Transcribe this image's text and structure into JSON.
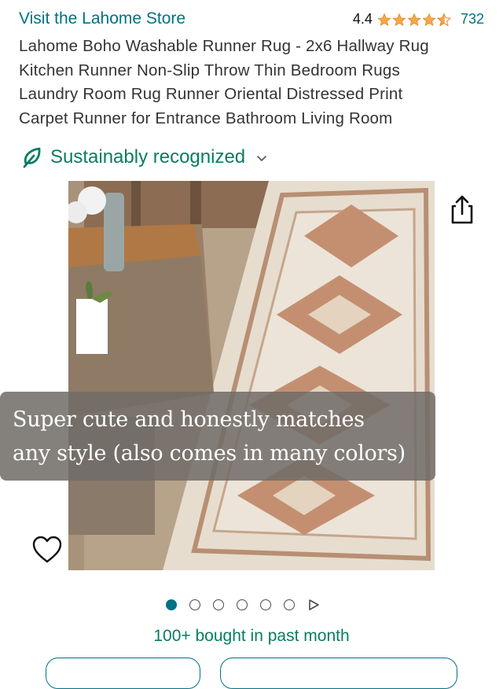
{
  "store": {
    "link_text": "Visit the Lahome Store"
  },
  "rating": {
    "value": "4.4",
    "stars": 4.4,
    "review_count": "732",
    "star_color": "#f3a847"
  },
  "product": {
    "title_lines": [
      "Lahome Boho Washable Runner Rug - 2x6 Hallway Rug",
      "Kitchen Runner Non-Slip Throw Thin Bedroom Rugs",
      "Laundry Room Rug Runner Oriental Distressed Print",
      "Carpet Runner for Entrance Bathroom Living Room"
    ]
  },
  "sustainability": {
    "label": "Sustainably recognized",
    "icon": "leaf-icon",
    "color": "#067d62"
  },
  "image": {
    "caption_lines": [
      "Super cute and honestly matches",
      "any style (also comes in many colors)"
    ],
    "share_icon": "share-icon",
    "favorite_icon": "heart-icon"
  },
  "carousel": {
    "image_count": 6,
    "active_index": 0,
    "has_video": true,
    "accent": "#007185"
  },
  "social_proof": {
    "bought_text": "100+ bought in past month"
  }
}
